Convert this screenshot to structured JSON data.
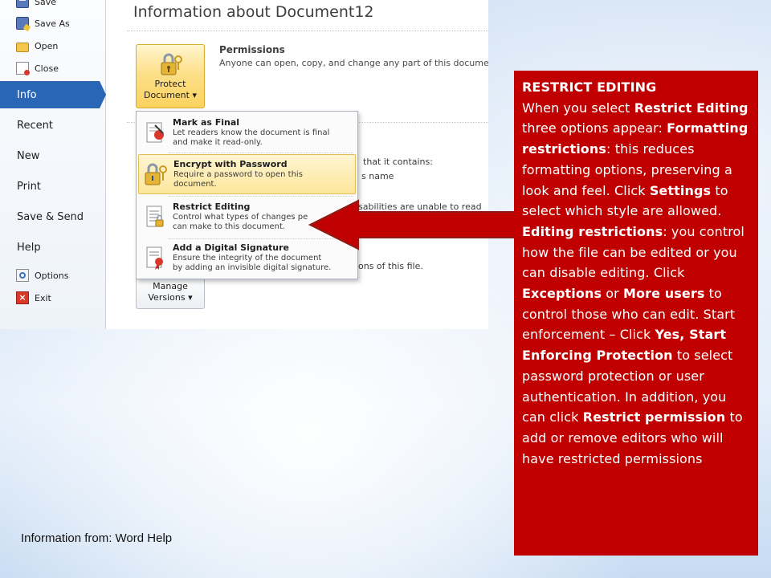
{
  "nav": {
    "save": "Save",
    "save_as": "Save As",
    "open": "Open",
    "close": "Close",
    "info": "Info",
    "recent": "Recent",
    "new": "New",
    "print": "Print",
    "save_send": "Save & Send",
    "help": "Help",
    "options": "Options",
    "exit": "Exit"
  },
  "info": {
    "title": "Information about Document12",
    "protect_button": {
      "line1": "Protect",
      "line2": "Document ▾"
    },
    "versions_button": {
      "line1": "Manage",
      "line2": "Versions ▾"
    },
    "permissions_heading": "Permissions",
    "permissions_desc": "Anyone can open, copy, and change any part of this document.",
    "partial_1": "that it contains:",
    "partial_2": "s name",
    "partial_3": "sabilities are unable to read",
    "partial_4": "ons of this file."
  },
  "protect_menu": [
    {
      "title": "Mark as Final",
      "desc1": "Let readers know the document is final",
      "desc2": "and make it read-only.",
      "icon": "mark-as-final-icon",
      "highlighted": false
    },
    {
      "title": "Encrypt with Password",
      "desc1": "Require a password to open this",
      "desc2": "document.",
      "icon": "encrypt-lock-icon",
      "highlighted": true
    },
    {
      "title": "Restrict Editing",
      "desc1": "Control what types of changes pe",
      "desc2": "can make to this document.",
      "icon": "restrict-editing-icon",
      "highlighted": false
    },
    {
      "title": "Add a Digital Signature",
      "desc1": "Ensure the integrity of the document",
      "desc2": "by adding an invisible digital signature.",
      "icon": "digital-signature-icon",
      "highlighted": false
    }
  ],
  "callout": {
    "heading": "RESTRICT EDITING",
    "t1": "When you select ",
    "b1": "Restrict Editing",
    "t2": " three options appear: ",
    "b2": "Formatting restrictions",
    "t3": ": this reduces formatting options, preserving a look and feel. Click ",
    "b3": "Settings",
    "t4": " to select which style are allowed. ",
    "b4": "Editing restrictions",
    "t5": ": you control how the file can be edited or you can disable editing. Click ",
    "b5": "Exceptions",
    "t6": " or ",
    "b6": "More users",
    "t7": " to control those who can edit. Start enforcement – Click ",
    "b7": "Yes, Start Enforcing Protection",
    "t8": " to select password protection or user authentication. In addition, you can click ",
    "b8": "Restrict permission",
    "t9": " to add or remove editors who will have restricted permissions"
  },
  "source": "Information from:  Word Help",
  "colors": {
    "callout_bg": "#c00000",
    "arrow_fill": "#c00000",
    "nav_active": "#2a66b6",
    "highlight": "#fde59a"
  }
}
